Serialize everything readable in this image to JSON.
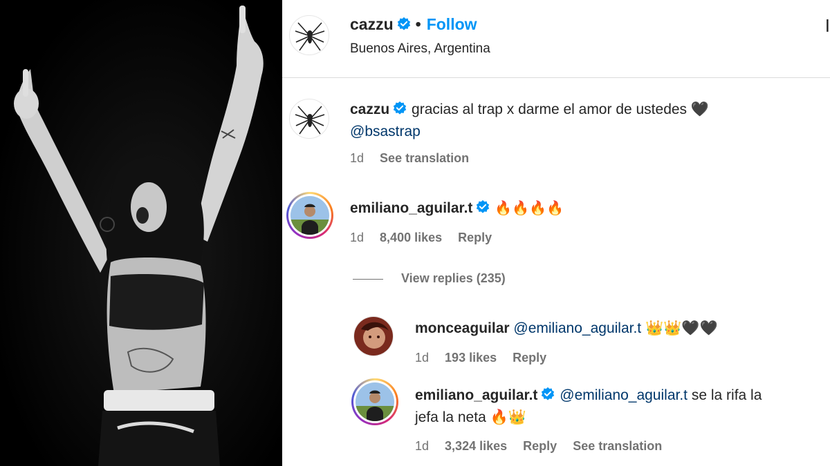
{
  "photo": {
    "alt": ""
  },
  "post_header": {
    "username": "cazzu",
    "separator": "•",
    "follow_label": "Follow",
    "location": "Buenos Aires, Argentina",
    "more_label": "I"
  },
  "caption": {
    "username": "cazzu",
    "text": "gracias al trap x darme el amor de ustedes",
    "emoji": "🖤",
    "mention": "@bsastrap",
    "time": "1d",
    "translate_label": "See translation"
  },
  "comments": [
    {
      "username": "emiliano_aguilar.t",
      "verified": true,
      "text_emoji": "🔥🔥🔥🔥",
      "time": "1d",
      "likes": "8,400 likes",
      "reply_label": "Reply",
      "view_replies": "View replies (235)"
    }
  ],
  "replies": [
    {
      "username": "monceaguilar",
      "mention": "@emiliano_aguilar.t",
      "emoji_text": "👑👑🖤🖤",
      "time": "1d",
      "likes": "193 likes",
      "reply_label": "Reply"
    },
    {
      "username": "emiliano_aguilar.t",
      "verified": true,
      "mention": "@emiliano_aguilar.t",
      "text_line1": "se la rifa la",
      "text_line2": "jefa la neta",
      "emoji_text": "🔥👑",
      "time": "1d",
      "likes": "3,324 likes",
      "reply_label": "Reply",
      "translate_label": "See translation"
    }
  ],
  "colors": {
    "link_blue": "#0095f6",
    "mention_blue": "#00376b",
    "verified_blue": "#0095f6",
    "meta_gray": "#737373"
  }
}
